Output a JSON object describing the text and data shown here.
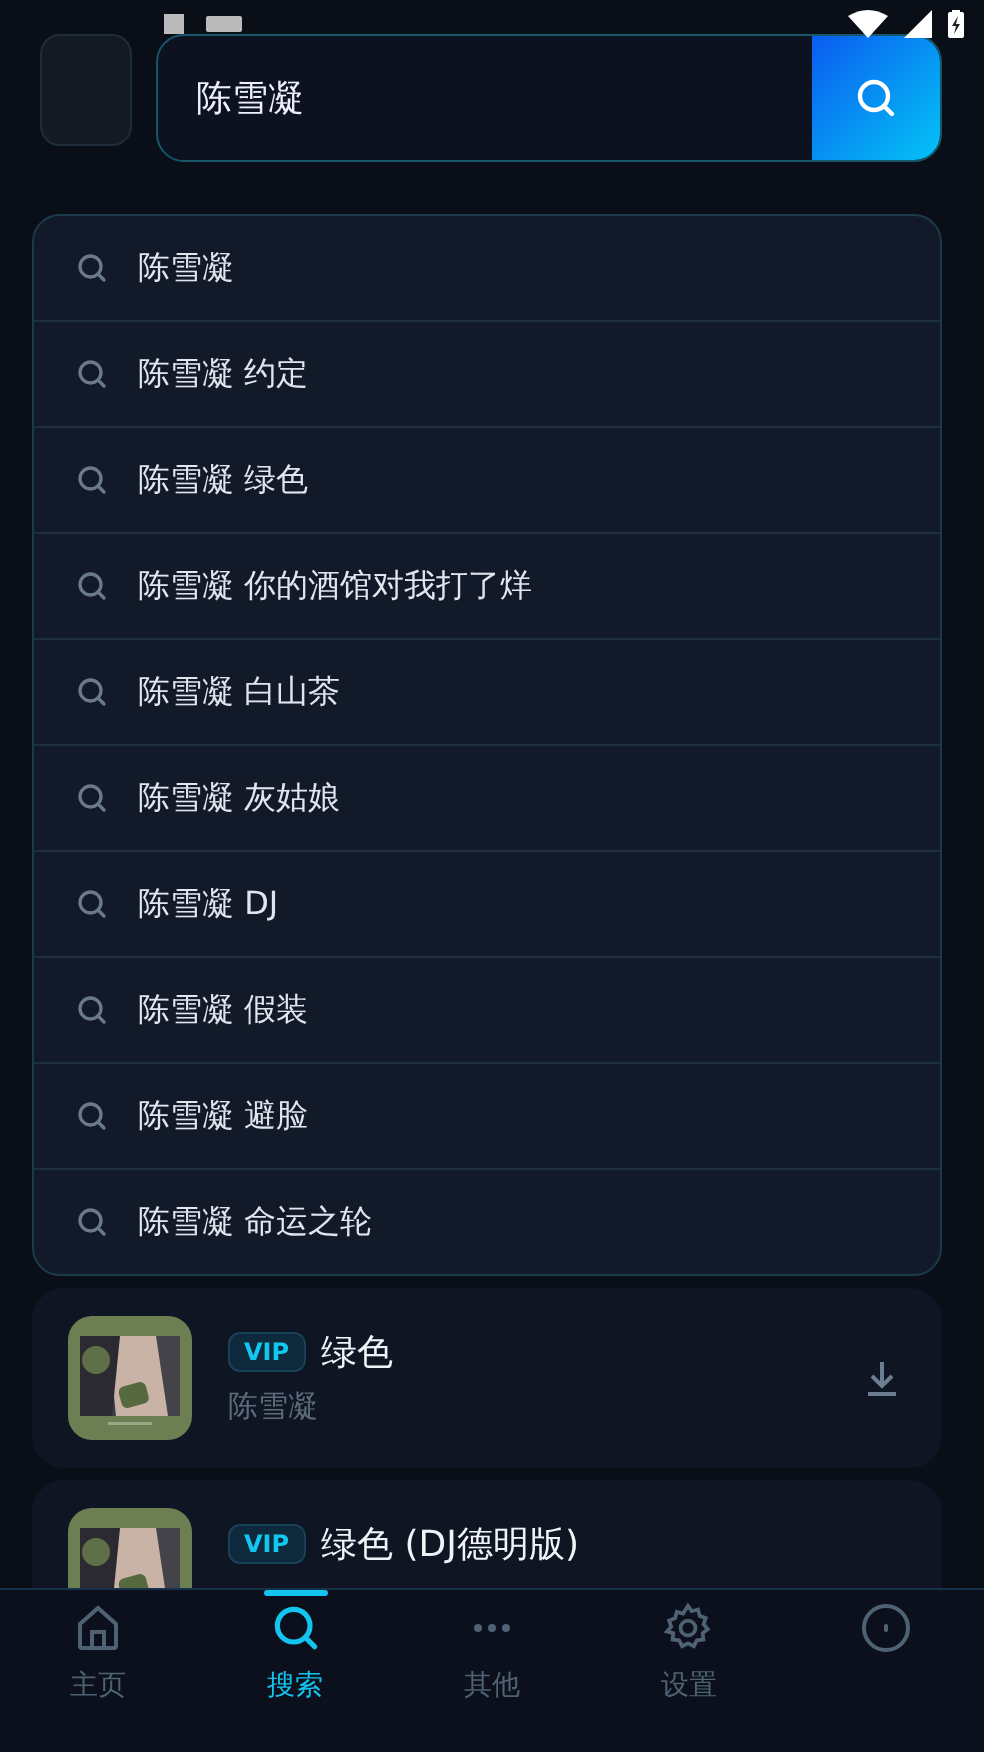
{
  "search": {
    "value": "陈雪凝"
  },
  "suggestions": [
    {
      "text": "陈雪凝"
    },
    {
      "text": "陈雪凝 约定"
    },
    {
      "text": "陈雪凝 绿色"
    },
    {
      "text": "陈雪凝 你的酒馆对我打了烊"
    },
    {
      "text": "陈雪凝 白山茶"
    },
    {
      "text": "陈雪凝 灰姑娘"
    },
    {
      "text": "陈雪凝 DJ"
    },
    {
      "text": "陈雪凝 假装"
    },
    {
      "text": "陈雪凝 避脸"
    },
    {
      "text": "陈雪凝 命运之轮"
    }
  ],
  "songs": [
    {
      "badge": "VIP",
      "title": "绿色",
      "artist": "陈雪凝",
      "downloadable": true
    },
    {
      "badge": "VIP",
      "title": "绿色 (DJ德明版)",
      "downloadable": false
    }
  ],
  "nav": [
    {
      "label": "主页",
      "selected": false
    },
    {
      "label": "搜索",
      "selected": true
    },
    {
      "label": "其他",
      "selected": false
    },
    {
      "label": "设置",
      "selected": false
    },
    {
      "selected": false
    }
  ]
}
